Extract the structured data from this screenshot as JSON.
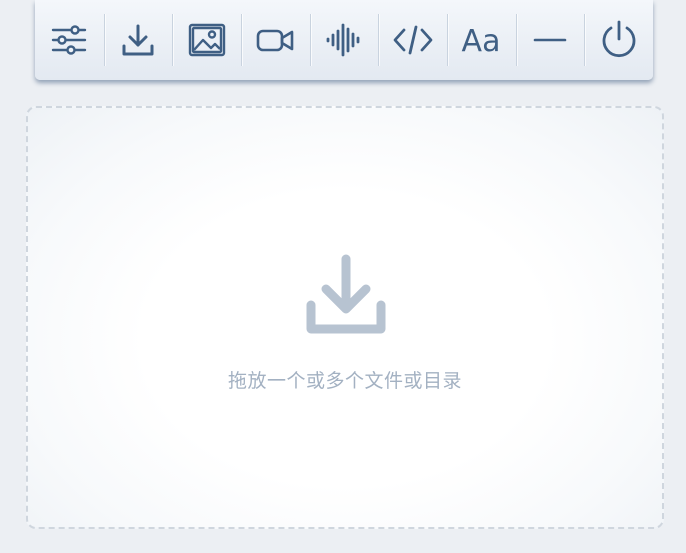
{
  "toolbar": {
    "buttons": [
      {
        "icon": "sliders-icon"
      },
      {
        "icon": "download-icon"
      },
      {
        "icon": "image-icon"
      },
      {
        "icon": "video-icon"
      },
      {
        "icon": "audio-waveform-icon"
      },
      {
        "icon": "code-icon"
      },
      {
        "icon": "font-icon",
        "label": "Aa"
      },
      {
        "icon": "minimize-icon"
      },
      {
        "icon": "power-icon"
      }
    ]
  },
  "dropzone": {
    "icon": "drop-download-icon",
    "text": "拖放一个或多个文件或目录"
  },
  "colors": {
    "icon": "#3f5f84",
    "toolbar_bg": "#e9eef4",
    "drop_icon": "#b7c3d1",
    "drop_text": "#a3b1c2",
    "dashed_border": "#cfd6de",
    "page_bg": "#eceff3"
  }
}
